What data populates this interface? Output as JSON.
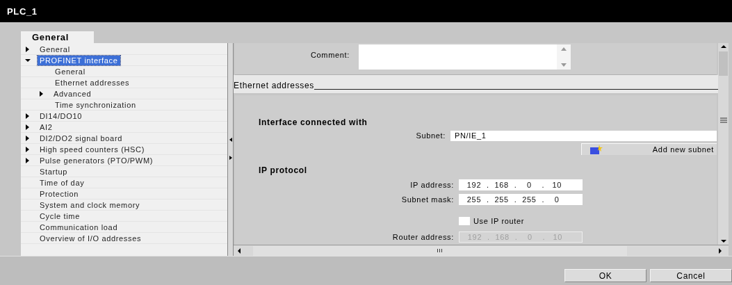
{
  "window": {
    "title": "PLC_1"
  },
  "tabs": [
    {
      "label": "General",
      "selected": true
    }
  ],
  "tree": [
    {
      "label": "General",
      "kind": "folder",
      "expanded": false,
      "selected": false
    },
    {
      "label": "PROFINET interface",
      "kind": "folder",
      "expanded": true,
      "selected": true,
      "children": [
        {
          "label": "General",
          "kind": "page",
          "selected": false
        },
        {
          "label": "Ethernet addresses",
          "kind": "page",
          "selected": false
        },
        {
          "label": "Advanced",
          "kind": "folder",
          "expanded": false,
          "selected": false
        },
        {
          "label": "Time synchronization",
          "kind": "page",
          "selected": false
        }
      ]
    },
    {
      "label": "DI14/DO10",
      "kind": "folder",
      "expanded": false,
      "selected": false
    },
    {
      "label": "AI2",
      "kind": "folder",
      "expanded": false,
      "selected": false
    },
    {
      "label": "DI2/DO2 signal board",
      "kind": "folder",
      "expanded": false,
      "selected": false
    },
    {
      "label": "High speed counters (HSC)",
      "kind": "folder",
      "expanded": false,
      "selected": false
    },
    {
      "label": "Pulse generators (PTO/PWM)",
      "kind": "folder",
      "expanded": false,
      "selected": false
    },
    {
      "label": "Startup",
      "kind": "page",
      "selected": false
    },
    {
      "label": "Time of day",
      "kind": "page",
      "selected": false
    },
    {
      "label": "Protection",
      "kind": "page",
      "selected": false
    },
    {
      "label": "System and clock memory",
      "kind": "page",
      "selected": false
    },
    {
      "label": "Cycle time",
      "kind": "page",
      "selected": false
    },
    {
      "label": "Communication load",
      "kind": "page",
      "selected": false
    },
    {
      "label": "Overview of I/O addresses",
      "kind": "page",
      "selected": false
    }
  ],
  "comment": {
    "label": "Comment:"
  },
  "section": {
    "title": "Ethernet addresses"
  },
  "interface": {
    "heading": "Interface connected with",
    "subnet_label": "Subnet:",
    "subnet_value": "PN/IE_1",
    "add_button": "Add new subnet"
  },
  "ip": {
    "heading": "IP protocol",
    "separator": ".",
    "fields": [
      {
        "label": "IP address:",
        "octets": [
          "192",
          "168",
          "0",
          "10"
        ],
        "disabled": false
      },
      {
        "label": "Subnet mask:",
        "octets": [
          "255",
          "255",
          "255",
          "0"
        ],
        "disabled": false
      }
    ],
    "router_checkbox": {
      "label": "Use IP router",
      "checked": false
    },
    "router": {
      "label": "Router address:",
      "octets": [
        "192",
        "168",
        "0",
        "10"
      ],
      "disabled": true
    }
  },
  "hscroll": {
    "grip": "III"
  },
  "buttons": [
    {
      "label": "OK"
    },
    {
      "label": "Cancel"
    }
  ]
}
